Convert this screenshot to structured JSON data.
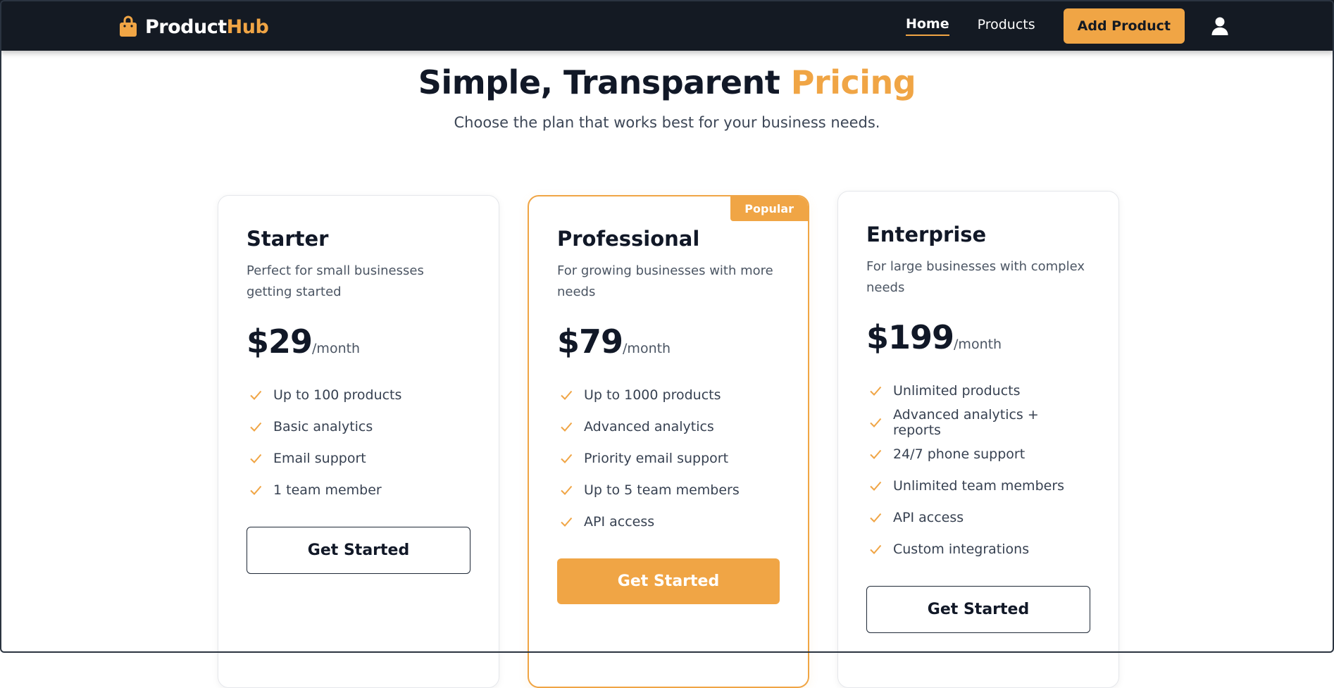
{
  "header": {
    "brand_main": "Product",
    "brand_accent": "Hub",
    "nav": [
      {
        "label": "Home",
        "active": true
      },
      {
        "label": "Products",
        "active": false
      }
    ],
    "add_product_label": "Add Product",
    "icons": {
      "brand": "shopping-bag-icon",
      "user": "user-icon"
    }
  },
  "hero": {
    "title_main": "Simple, Transparent",
    "title_accent": "Pricing",
    "subtitle": "Choose the plan that works best for your business needs."
  },
  "plans": [
    {
      "name": "Starter",
      "description": "Perfect for small businesses getting started",
      "price": "$29",
      "period": "/month",
      "features": [
        "Up to 100 products",
        "Basic analytics",
        "Email support",
        "1 team member"
      ],
      "cta": "Get Started",
      "featured": false
    },
    {
      "name": "Professional",
      "badge": "Popular",
      "description": "For growing businesses with more needs",
      "price": "$79",
      "period": "/month",
      "features": [
        "Up to 1000 products",
        "Advanced analytics",
        "Priority email support",
        "Up to 5 team members",
        "API access"
      ],
      "cta": "Get Started",
      "featured": true
    },
    {
      "name": "Enterprise",
      "description": "For large businesses with complex needs",
      "price": "$199",
      "period": "/month",
      "features": [
        "Unlimited products",
        "Advanced analytics + reports",
        "24/7 phone support",
        "Unlimited team members",
        "API access",
        "Custom integrations"
      ],
      "cta": "Get Started",
      "featured": false
    }
  ],
  "colors": {
    "accent": "#f0a545",
    "nav_bg": "#141a23",
    "text_dark": "#111827",
    "text_muted": "#4b5563"
  }
}
